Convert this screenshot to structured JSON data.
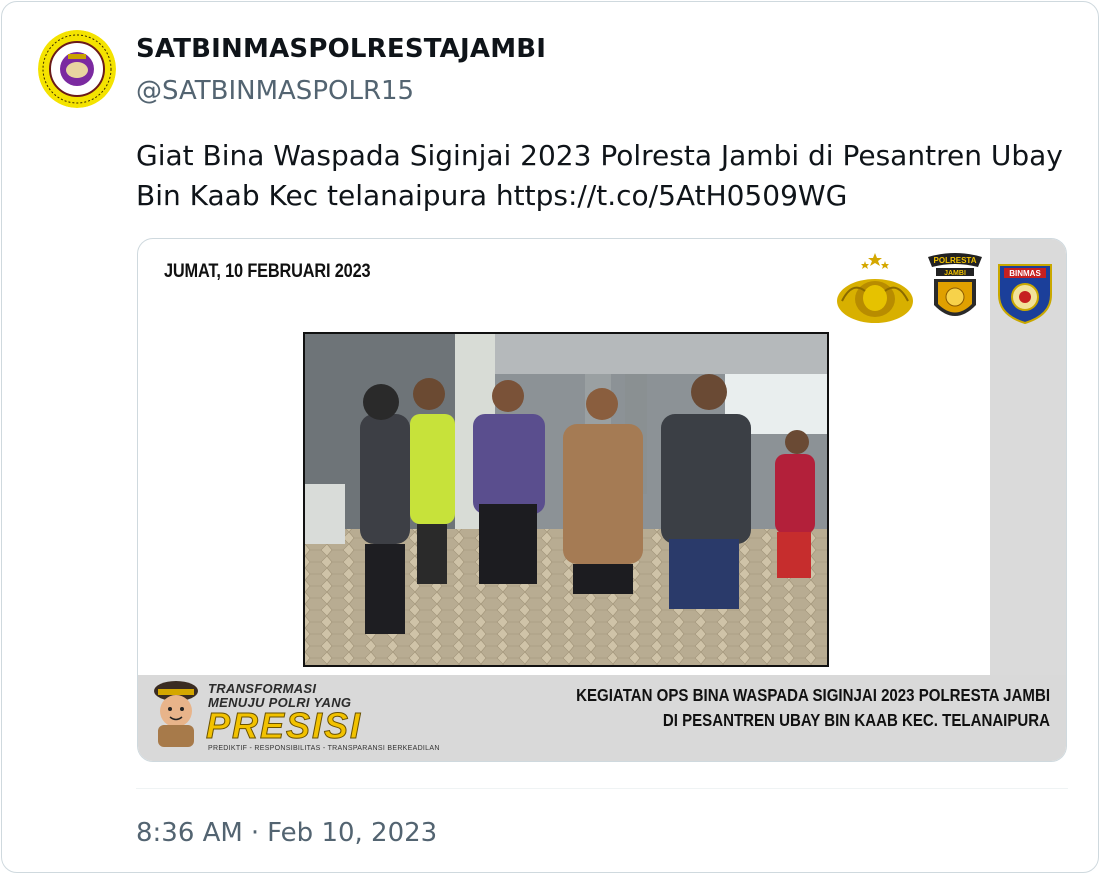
{
  "tweet": {
    "display_name": "SATBINMASPOLRESTAJAMBI",
    "handle": "@SATBINMASPOLR15",
    "text_before_link": "Giat Bina Waspada Siginjai 2023 Polresta Jambi di Pesantren Ubay Bin Kaab Kec telanaipura ",
    "link": "https://t.co/5AtH0509WG",
    "time": "8:36 AM",
    "separator": "·",
    "date": "Feb 10, 2023"
  },
  "media": {
    "date_label": "JUMAT, 10 FEBRUARI 2023",
    "caption_line1": "KEGIATAN OPS BINA WASPADA SIGINJAI 2023 POLRESTA JAMBI",
    "caption_line2": "DI PESANTREN UBAY BIN KAAB KEC. TELANAIPURA",
    "logos": [
      "polri-emblem-icon",
      "polresta-jambi-badge-icon",
      "binmas-shield-icon"
    ],
    "polresta_badge_text": "POLRESTA",
    "polresta_badge_subtext": "JAMBI",
    "binmas_text": "BINMAS",
    "presisi": {
      "line1": "TRANSFORMASI",
      "line2": "MENUJU POLRI YANG",
      "word": "PRESISI",
      "tagline": "PREDIKTIF - RESPONSIBILITAS - TRANSPARANSI BERKEADILAN"
    }
  },
  "colors": {
    "text_primary": "#0f1419",
    "text_secondary": "#536471",
    "border": "#cfd9de",
    "band_gray": "#d9d9d9",
    "presisi_yellow": "#f2c200"
  }
}
